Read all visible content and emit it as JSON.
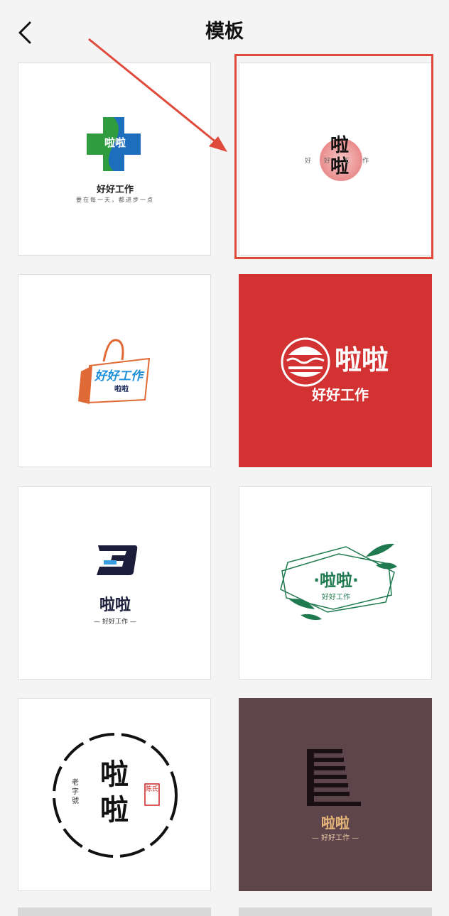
{
  "header": {
    "title": "模板"
  },
  "colors": {
    "accent_red": "#e04a3b",
    "card4_bg": "#d33233",
    "card8_bg": "#5e444b",
    "green": "#1f7a4f"
  },
  "templates": [
    {
      "name": "啦啦",
      "tagline": "好好工作",
      "slogan": "要在每一天，都进步一点"
    },
    {
      "name": "啦啦",
      "tagline": "好好工作"
    },
    {
      "name": "啦啦",
      "tagline": "好好工作"
    },
    {
      "name": "啦啦",
      "tagline": "好好工作"
    },
    {
      "name": "啦啦",
      "tagline": "— 好好工作 —"
    },
    {
      "name": "·啦啦·",
      "tagline": "好好工作"
    },
    {
      "name": "啦啦",
      "side_text": "老字號",
      "seal": "陈氏"
    },
    {
      "name": "啦啦",
      "tagline": "— 好好工作 —"
    }
  ]
}
